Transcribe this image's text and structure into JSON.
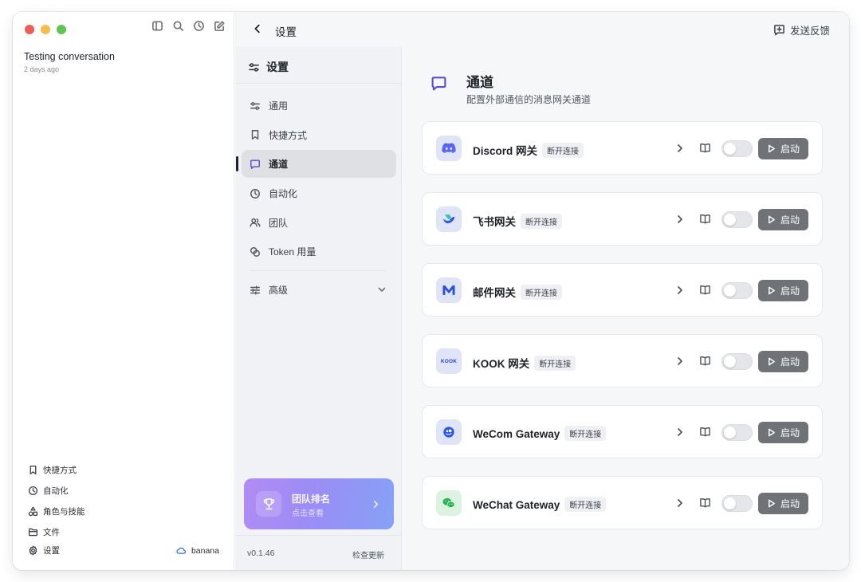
{
  "sidebar": {
    "conversation": {
      "title": "Testing conversation",
      "time": "2 days ago"
    },
    "nav": [
      {
        "icon": "bookmark-icon",
        "label": "快捷方式"
      },
      {
        "icon": "clock-icon",
        "label": "自动化"
      },
      {
        "icon": "shapes-icon",
        "label": "角色与技能"
      },
      {
        "icon": "folder-icon",
        "label": "文件"
      }
    ],
    "settings_label": "设置",
    "workspace_label": "banana"
  },
  "titlebar": {
    "title": "设置",
    "feedback_label": "发送反馈"
  },
  "settings_nav": {
    "heading": "设置",
    "items": [
      {
        "icon": "sliders-icon",
        "label": "通用"
      },
      {
        "icon": "bookmark-icon",
        "label": "快捷方式"
      },
      {
        "icon": "message-icon",
        "label": "通道",
        "active": true
      },
      {
        "icon": "clock-icon",
        "label": "自动化"
      },
      {
        "icon": "users-icon",
        "label": "团队"
      },
      {
        "icon": "coins-icon",
        "label": "Token 用量"
      }
    ],
    "advanced_label": "高级",
    "team_card": {
      "title": "团队排名",
      "subtitle": "点击查看"
    },
    "version": "v0.1.46",
    "check_update": "检查更新"
  },
  "content": {
    "title": "通道",
    "subtitle": "配置外部通信的消息网关通道",
    "gateways": [
      {
        "name": "Discord 网关",
        "status": "断开连接",
        "logo": "discord-logo-icon",
        "enabled": false,
        "action": "启动"
      },
      {
        "name": "飞书网关",
        "status": "断开连接",
        "logo": "feishu-logo-icon",
        "enabled": false,
        "action": "启动"
      },
      {
        "name": "邮件网关",
        "status": "断开连接",
        "logo": "mail-logo-icon",
        "enabled": false,
        "action": "启动"
      },
      {
        "name": "KOOK 网关",
        "status": "断开连接",
        "logo": "kook-logo-icon",
        "logo_text": "KOOK",
        "enabled": false,
        "action": "启动"
      },
      {
        "name": "WeCom Gateway",
        "status": "断开连接",
        "logo": "wecom-logo-icon",
        "enabled": false,
        "action": "启动"
      },
      {
        "name": "WeChat Gateway",
        "status": "断开连接",
        "logo": "wechat-logo-icon",
        "enabled": false,
        "action": "启动"
      }
    ]
  },
  "colors": {
    "accent": "#5b4ccf",
    "start_button": "#6f7378",
    "window_close": "#ee5d57",
    "window_minimize": "#f5bd4f",
    "window_zoom": "#5fc454"
  }
}
